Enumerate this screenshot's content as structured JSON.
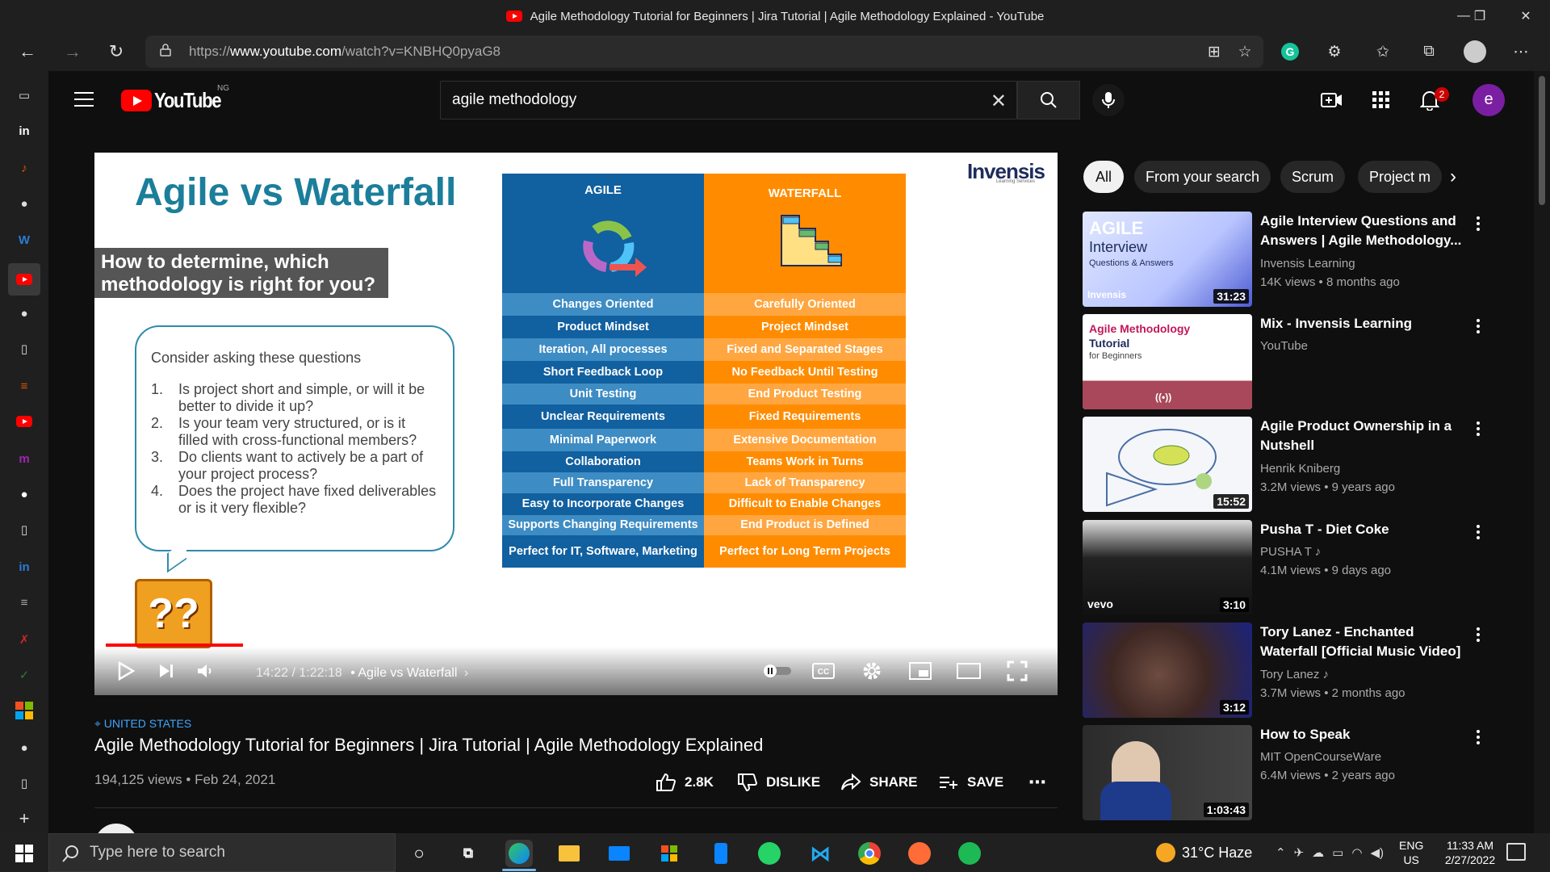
{
  "window": {
    "title": "Agile Methodology Tutorial for Beginners | Jira Tutorial | Agile Methodology Explained - YouTube",
    "minimize": "—",
    "restore": "❐",
    "close": "✕"
  },
  "browser": {
    "url_prefix": "https://",
    "url_domain": "www.youtube.com",
    "url_path": "/watch?v=KNBHQ0pyaG8"
  },
  "youtube": {
    "logo_text": "YouTube",
    "country_code": "NG",
    "search_value": "agile methodology",
    "search_placeholder": "Search",
    "notification_count": "2",
    "avatar_letter": "e"
  },
  "slide": {
    "title": "Agile vs Waterfall",
    "brand": "Invensis",
    "brand_sub": "Learning Services",
    "question_box": "How to determine, which methodology is right for you?",
    "bubble_intro": "Consider asking these questions",
    "questions": [
      {
        "n": "1.",
        "text": "Is project short and simple, or will it be better to divide it up?"
      },
      {
        "n": "2.",
        "text": "Is your team very structured, or is it filled with cross-functional members?"
      },
      {
        "n": "3.",
        "text": "Do clients want to actively be a part of your project process?"
      },
      {
        "n": "4.",
        "text": "Does the project have fixed deliverables or is it very flexible?"
      }
    ],
    "qblock": "??",
    "agile_header": "AGILE",
    "waterfall_header": "WATERFALL",
    "agile_rows": [
      "Changes Oriented",
      "Product Mindset",
      "Iteration, All processes",
      "Short Feedback Loop",
      "Unit Testing",
      "Unclear Requirements",
      "Minimal Paperwork",
      "Collaboration",
      "Full Transparency",
      "Easy to Incorporate Changes",
      "Supports Changing Requirements",
      "Perfect for IT, Software, Marketing"
    ],
    "waterfall_rows": [
      "Carefully Oriented",
      "Project Mindset",
      "Fixed and Separated Stages",
      "No Feedback Until Testing",
      "End Product Testing",
      "Fixed Requirements",
      "Extensive Documentation",
      "Teams Work in Turns",
      "Lack of Transparency",
      "Difficult to Enable Changes",
      "End Product is Defined",
      "Perfect for Long Term Projects"
    ]
  },
  "player": {
    "time": "14:22 / 1:22:18",
    "chapter": "• Agile vs Waterfall",
    "progress_fraction": 0.146,
    "buffer_fraction": 0.16
  },
  "video": {
    "location": "UNITED STATES",
    "title": "Agile Methodology Tutorial for Beginners | Jira Tutorial | Agile Methodology Explained",
    "meta": "194,125 views • Feb 24, 2021",
    "likes": "2.8K",
    "dislike": "DISLIKE",
    "share": "SHARE",
    "save": "SAVE"
  },
  "chips": [
    "All",
    "From your search",
    "Scrum",
    "Project m"
  ],
  "recommendations": [
    {
      "title": "Agile Interview Questions and Answers | Agile Methodology...",
      "channel": "Invensis Learning",
      "views": "14K views • 8 months ago",
      "duration": "31:23",
      "thumb_text": "AGILE"
    },
    {
      "title": "Mix - Invensis Learning",
      "channel": "YouTube",
      "views": "",
      "duration": "",
      "thumb_text": "Agile Methodology"
    },
    {
      "title": "Agile Product Ownership in a Nutshell",
      "channel": "Henrik Kniberg",
      "views": "3.2M views • 9 years ago",
      "duration": "15:52",
      "thumb_text": ""
    },
    {
      "title": "Pusha T - Diet Coke",
      "channel": "PUSHA T ♪",
      "views": "4.1M views • 9 days ago",
      "duration": "3:10",
      "thumb_text": "vevo"
    },
    {
      "title": "Tory Lanez - Enchanted Waterfall [Official Music Video]",
      "channel": "Tory Lanez ♪",
      "views": "3.7M views • 2 months ago",
      "duration": "3:12",
      "thumb_text": ""
    },
    {
      "title": "How to Speak",
      "channel": "MIT OpenCourseWare",
      "views": "6.4M views • 2 years ago",
      "duration": "1:03:43",
      "thumb_text": ""
    }
  ],
  "taskbar": {
    "search_placeholder": "Type here to search",
    "weather": "31°C  Haze",
    "lang1": "ENG",
    "lang2": "US",
    "time": "11:33 AM",
    "date": "2/27/2022"
  }
}
